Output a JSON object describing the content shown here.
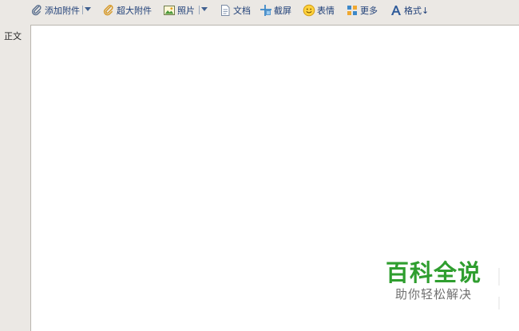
{
  "toolbar": {
    "add_attachment": "添加附件",
    "large_attachment": "超大附件",
    "photo": "照片",
    "document": "文档",
    "screenshot": "截屏",
    "emoticon": "表情",
    "more": "更多",
    "format": "格式↓"
  },
  "editor": {
    "body_label": "正文"
  },
  "watermark": {
    "title": "百科全说",
    "subtitle": "助你轻松解决"
  },
  "colors": {
    "toolbar_text": "#1f3f77",
    "background": "#ebe8e4",
    "editor_background": "#ffffff",
    "watermark_green": "#2f9e2f",
    "watermark_gray": "#6f6f6f"
  }
}
